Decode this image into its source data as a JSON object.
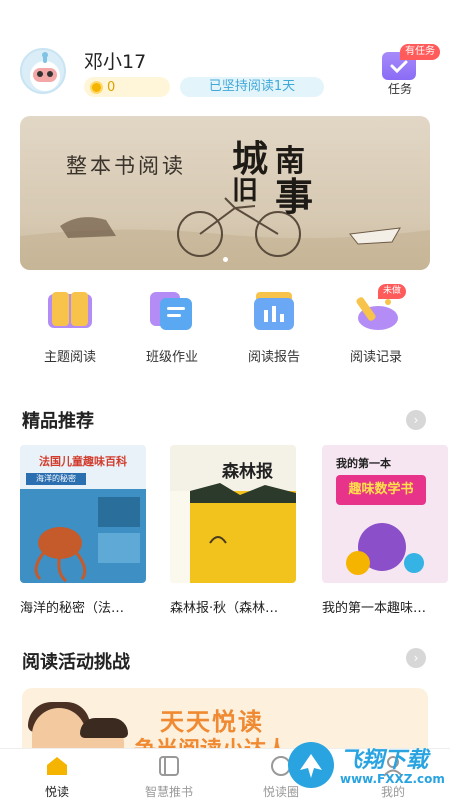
{
  "header": {
    "username": "邓小17",
    "coins": "0",
    "streak": "已坚持阅读1天",
    "task_badge": "有任务",
    "task_label": "任务"
  },
  "banner": {
    "subtitle": "整本书阅读",
    "title_chars": [
      "城",
      "南",
      "旧",
      "事"
    ]
  },
  "features": [
    {
      "label": "主题阅读",
      "icon": "book-icon",
      "color": "#f6b73c"
    },
    {
      "label": "班级作业",
      "icon": "homework-icon",
      "color": "#5aa7f2"
    },
    {
      "label": "阅读报告",
      "icon": "report-icon",
      "color": "#5aa7f2"
    },
    {
      "label": "阅读记录",
      "icon": "record-icon",
      "color": "#a78bfa",
      "badge": "未做"
    }
  ],
  "featured": {
    "title": "精品推荐",
    "books": [
      {
        "title": "海洋的秘密（法…",
        "cover_title": "法国儿童趣味百科",
        "cover_sub": "海洋的秘密"
      },
      {
        "title": "森林报·秋（森林…",
        "cover_title": "森林报"
      },
      {
        "title": "我的第一本趣味…",
        "cover_title": "我的第一本",
        "cover_sub": "趣味数学书"
      }
    ]
  },
  "activity": {
    "title": "阅读活动挑战",
    "banner_line1": "天天悦读",
    "banner_line2": "争当阅读小达人"
  },
  "tabbar": {
    "tabs": [
      {
        "label": "悦读",
        "active": true
      },
      {
        "label": "智慧推书",
        "active": false
      },
      {
        "label": "悦读圈",
        "active": false
      },
      {
        "label": "我的",
        "active": false
      }
    ]
  },
  "watermark": {
    "text": "飞翔下载",
    "url": "www.FXXZ.com"
  }
}
